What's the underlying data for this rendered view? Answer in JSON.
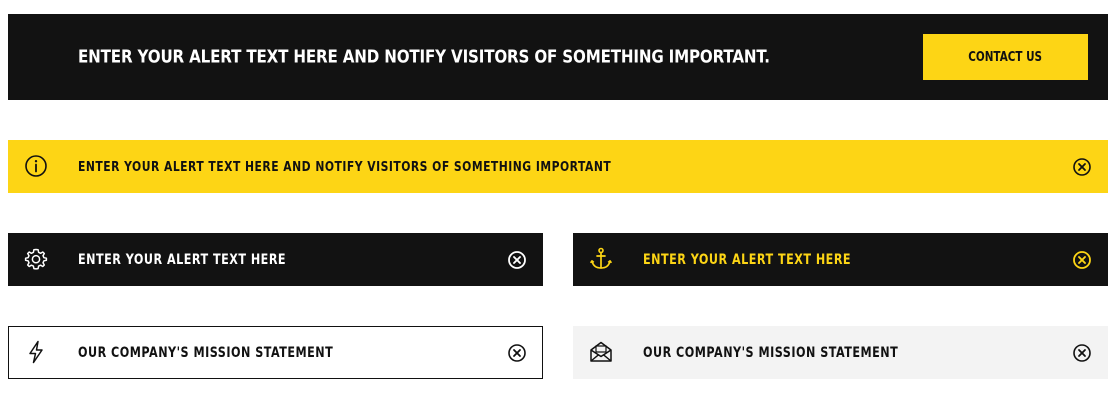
{
  "colors": {
    "accent": "#fdd515",
    "dark": "#121212",
    "light": "#f3f3f3",
    "white": "#ffffff",
    "text_dark": "#111111"
  },
  "banners": [
    {
      "style": "dark-with-button",
      "text": "ENTER YOUR ALERT TEXT HERE AND NOTIFY VISITORS OF SOMETHING IMPORTANT.",
      "button_label": "CONTACT US"
    },
    {
      "style": "yellow",
      "icon": "info-icon",
      "text": "ENTER YOUR ALERT TEXT HERE AND NOTIFY VISITORS OF SOMETHING IMPORTANT",
      "close_icon": "close-circle-icon"
    },
    {
      "style": "dark",
      "icon": "gear-icon",
      "text": "ENTER YOUR ALERT TEXT HERE",
      "close_icon": "close-circle-icon"
    },
    {
      "style": "dark-yellow-text",
      "icon": "anchor-icon",
      "text": "ENTER YOUR ALERT TEXT HERE",
      "close_icon": "close-circle-icon"
    },
    {
      "style": "outlined",
      "icon": "lightning-icon",
      "text": "OUR COMPANY'S MISSION STATEMENT",
      "close_icon": "close-circle-icon"
    },
    {
      "style": "light-gray",
      "icon": "open-envelope-icon",
      "text": "OUR COMPANY'S MISSION STATEMENT",
      "close_icon": "close-circle-icon"
    }
  ]
}
